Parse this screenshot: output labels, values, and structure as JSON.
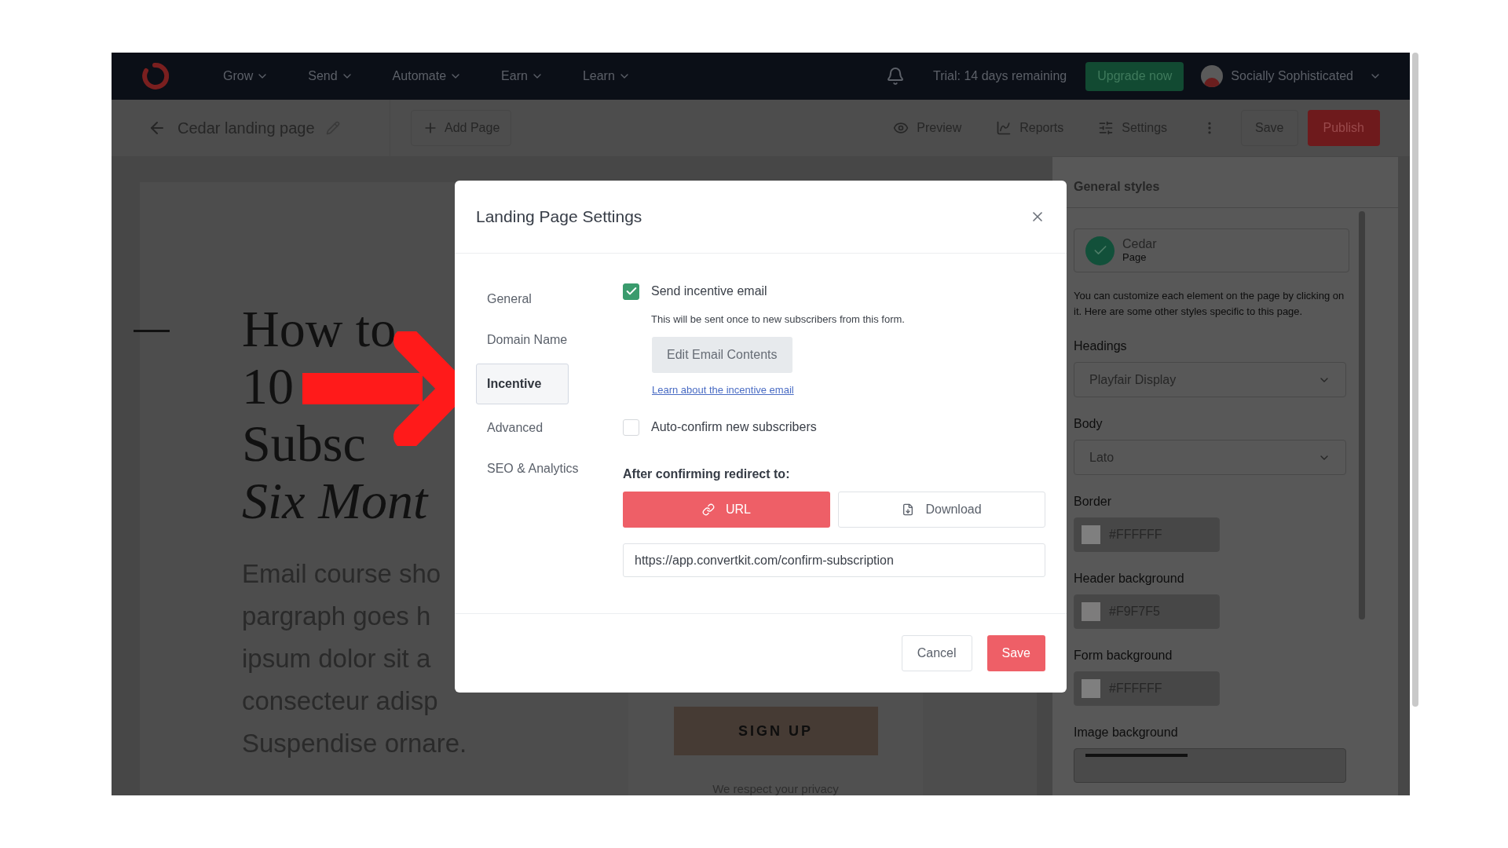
{
  "nav": {
    "items": [
      {
        "label": "Grow"
      },
      {
        "label": "Send"
      },
      {
        "label": "Automate"
      },
      {
        "label": "Earn"
      },
      {
        "label": "Learn"
      }
    ],
    "trial": "Trial: 14 days remaining",
    "upgrade": "Upgrade now",
    "account": "Socially Sophisticated"
  },
  "toolbar": {
    "title": "Cedar landing page",
    "add_page": "Add Page",
    "actions": [
      {
        "label": "Preview",
        "kind": "eye"
      },
      {
        "label": "Reports",
        "kind": "chart"
      },
      {
        "label": "Settings",
        "kind": "sliders"
      }
    ],
    "save": "Save",
    "publish": "Publish"
  },
  "page_preview": {
    "heading_lines": [
      {
        "text": "How to",
        "italic": false
      },
      {
        "text": "10",
        "italic": false
      },
      {
        "text": "Subsc",
        "italic": false
      },
      {
        "text": "Six Mont",
        "italic": true
      }
    ],
    "paragraph_lines": [
      "Email course sho",
      "pargraph goes h",
      "ipsum dolor sit a",
      "consecteur adisp",
      "Suspendise ornare."
    ],
    "signup_button": "SIGN UP",
    "privacy_note": "We respect your privacy"
  },
  "general_styles": {
    "title": "General styles",
    "theme": {
      "name": "Cedar",
      "type": "Page"
    },
    "description": "You can customize each element on the page by clicking on it. Here are some other styles specific to this page.",
    "fields": [
      {
        "label": "Headings",
        "kind": "select",
        "value": "Playfair Display"
      },
      {
        "label": "Body",
        "kind": "select",
        "value": "Lato"
      },
      {
        "label": "Border",
        "kind": "color",
        "value": "#FFFFFF"
      },
      {
        "label": "Header background",
        "kind": "color",
        "value": "#F9F7F5"
      },
      {
        "label": "Form background",
        "kind": "color",
        "value": "#FFFFFF"
      },
      {
        "label": "Image background",
        "kind": "image"
      }
    ]
  },
  "modal": {
    "title": "Landing Page Settings",
    "tabs": [
      {
        "label": "General",
        "selected": false
      },
      {
        "label": "Domain Name",
        "selected": false
      },
      {
        "label": "Incentive",
        "selected": true
      },
      {
        "label": "Advanced",
        "selected": false
      },
      {
        "label": "SEO & Analytics",
        "selected": false
      }
    ],
    "send_incentive": {
      "label": "Send incentive email",
      "checked": true
    },
    "description": "This will be sent once to new subscribers from this form.",
    "edit_button": "Edit Email Contents",
    "learn_link": "Learn about the incentive email",
    "auto_confirm": {
      "label": "Auto-confirm new subscribers",
      "checked": false
    },
    "redirect_label": "After confirming redirect to:",
    "redirect_options": [
      {
        "label": "URL",
        "kind": "link",
        "selected": true
      },
      {
        "label": "Download",
        "kind": "file",
        "selected": false
      }
    ],
    "url_value": "https://app.convertkit.com/confirm-subscription",
    "cancel": "Cancel",
    "save": "Save"
  }
}
